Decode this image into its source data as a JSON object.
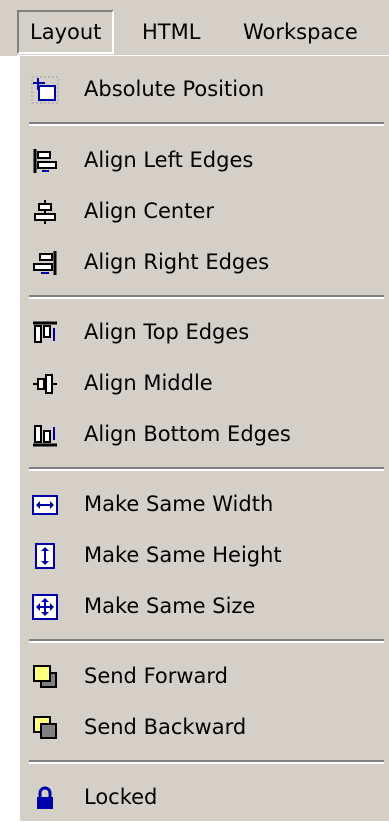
{
  "menubar": {
    "items": [
      {
        "label": "Layout"
      },
      {
        "label": "HTML"
      },
      {
        "label": "Workspace"
      }
    ]
  },
  "layout_menu": {
    "items": [
      {
        "label": "Absolute Position",
        "icon": "absolute-position-icon"
      },
      {
        "label": "Align Left Edges",
        "icon": "align-left-icon"
      },
      {
        "label": "Align Center",
        "icon": "align-center-icon"
      },
      {
        "label": "Align Right Edges",
        "icon": "align-right-icon"
      },
      {
        "label": "Align Top Edges",
        "icon": "align-top-icon"
      },
      {
        "label": "Align Middle",
        "icon": "align-middle-icon"
      },
      {
        "label": "Align Bottom Edges",
        "icon": "align-bottom-icon"
      },
      {
        "label": "Make Same Width",
        "icon": "same-width-icon"
      },
      {
        "label": "Make Same Height",
        "icon": "same-height-icon"
      },
      {
        "label": "Make Same Size",
        "icon": "same-size-icon"
      },
      {
        "label": "Send Forward",
        "icon": "send-forward-icon"
      },
      {
        "label": "Send Backward",
        "icon": "send-backward-icon"
      },
      {
        "label": "Locked",
        "icon": "lock-icon"
      }
    ]
  },
  "colors": {
    "menu_bg": "#d4d0c8",
    "shadow": "#808080",
    "highlight": "#ffffff",
    "icon_blue": "#0000a8",
    "icon_yellow": "#ffff80"
  }
}
